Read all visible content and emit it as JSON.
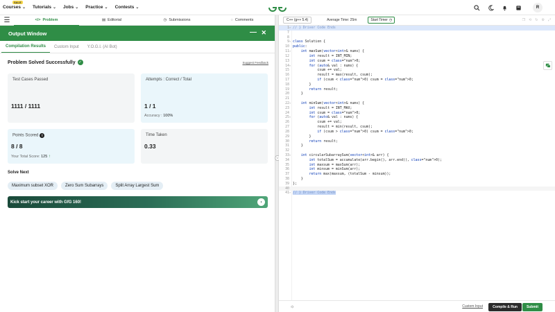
{
  "nav": {
    "items": [
      {
        "label": "Courses",
        "badge": "SALE"
      },
      {
        "label": "Tutorials"
      },
      {
        "label": "Jobs"
      },
      {
        "label": "Practice"
      },
      {
        "label": "Contests"
      }
    ],
    "avatar": "R"
  },
  "problem_tabs": [
    "Problem",
    "Editorial",
    "Submissions",
    "Comments"
  ],
  "output_window": {
    "title": "Output Window",
    "tabs": [
      "Compilation Results",
      "Custom Input",
      "Y.O.G.I. (AI Bot)"
    ],
    "status": "Problem Solved Successfully",
    "feedback_link": "Suggest Feedback",
    "test_cases_label": "Test Cases Passed",
    "test_cases_value": "1111 / 1111",
    "attempts_label": "Attempts : Correct / Total",
    "attempts_value": "1 / 1",
    "accuracy_label": "Accuracy :",
    "accuracy_value": "100%",
    "points_label": "Points Scored",
    "points_value": "8 / 8",
    "total_score_label": "Your Total Score:",
    "total_score_value": "125",
    "time_label": "Time Taken",
    "time_value": "0.33"
  },
  "solve_next": {
    "title": "Solve Next",
    "chips": [
      "Maximum subset XOR",
      "Zero Sum Subarrays",
      "Split Array Largest Sum"
    ],
    "banner": "Kick start your career with GfG 160!"
  },
  "editor": {
    "language": "C++ (g++ 5.4)",
    "avg_time": "Average Time: 25m",
    "timer_button": "Start Timer",
    "lines": [
      {
        "n": "1",
        "fold": true,
        "text": "// } Driver Code Ends",
        "style": "comment-hl"
      },
      {
        "n": "7",
        "fold": false,
        "text": ""
      },
      {
        "n": "8",
        "fold": false,
        "text": ""
      },
      {
        "n": "9",
        "fold": true,
        "text": "class Solution {"
      },
      {
        "n": "10",
        "fold": false,
        "text": "public:"
      },
      {
        "n": "11",
        "fold": true,
        "text": "    int maxSum(vector<int>& nums) {"
      },
      {
        "n": "12",
        "fold": false,
        "text": "        int result = INT_MIN;"
      },
      {
        "n": "13",
        "fold": false,
        "text": "        int csum = 0;"
      },
      {
        "n": "14",
        "fold": true,
        "text": "        for (auto& val : nums) {"
      },
      {
        "n": "15",
        "fold": false,
        "text": "            csum += val;"
      },
      {
        "n": "16",
        "fold": false,
        "text": "            result = max(result, csum);"
      },
      {
        "n": "17",
        "fold": false,
        "text": "            if (csum < 0) csum = 0;"
      },
      {
        "n": "18",
        "fold": false,
        "text": "        }"
      },
      {
        "n": "19",
        "fold": false,
        "text": "        return result;"
      },
      {
        "n": "20",
        "fold": false,
        "text": "    }"
      },
      {
        "n": "21",
        "fold": false,
        "text": ""
      },
      {
        "n": "22",
        "fold": true,
        "text": "    int minSum(vector<int>& nums) {"
      },
      {
        "n": "23",
        "fold": false,
        "text": "        int result = INT_MAX;"
      },
      {
        "n": "24",
        "fold": false,
        "text": "        int csum = 0;"
      },
      {
        "n": "25",
        "fold": true,
        "text": "        for (auto& val : nums) {"
      },
      {
        "n": "26",
        "fold": false,
        "text": "            csum += val;"
      },
      {
        "n": "27",
        "fold": false,
        "text": "            result = min(result, csum);"
      },
      {
        "n": "28",
        "fold": false,
        "text": "            if (csum > 0) csum = 0;"
      },
      {
        "n": "29",
        "fold": false,
        "text": "        }"
      },
      {
        "n": "30",
        "fold": false,
        "text": "        return result;"
      },
      {
        "n": "31",
        "fold": false,
        "text": "    }"
      },
      {
        "n": "32",
        "fold": false,
        "text": ""
      },
      {
        "n": "33",
        "fold": true,
        "text": "    int circularSubarraySum(vector<int>& arr) {"
      },
      {
        "n": "34",
        "fold": false,
        "text": "        int totalSum = accumulate(arr.begin(), arr.end(), 0);"
      },
      {
        "n": "35",
        "fold": false,
        "text": "        int maxsum = maxSum(arr);"
      },
      {
        "n": "36",
        "fold": false,
        "text": "        int minsum = minSum(arr);"
      },
      {
        "n": "37",
        "fold": false,
        "text": "        return max(maxsum, (totalSum - minsum));"
      },
      {
        "n": "38",
        "fold": false,
        "text": "    }"
      },
      {
        "n": "39",
        "fold": false,
        "text": "};"
      },
      {
        "n": "40",
        "fold": false,
        "text": "",
        "style": "cursor"
      },
      {
        "n": "41",
        "fold": true,
        "text": "// } Driver Code Ends",
        "style": "comment-sel"
      }
    ],
    "custom_input": "Custom Input",
    "compile_button": "Compile & Run",
    "submit_button": "Submit"
  },
  "colors": {
    "brand": "#2f8d46",
    "card_blue": "#eaf6fb",
    "card_gray": "#f3f5f6"
  }
}
